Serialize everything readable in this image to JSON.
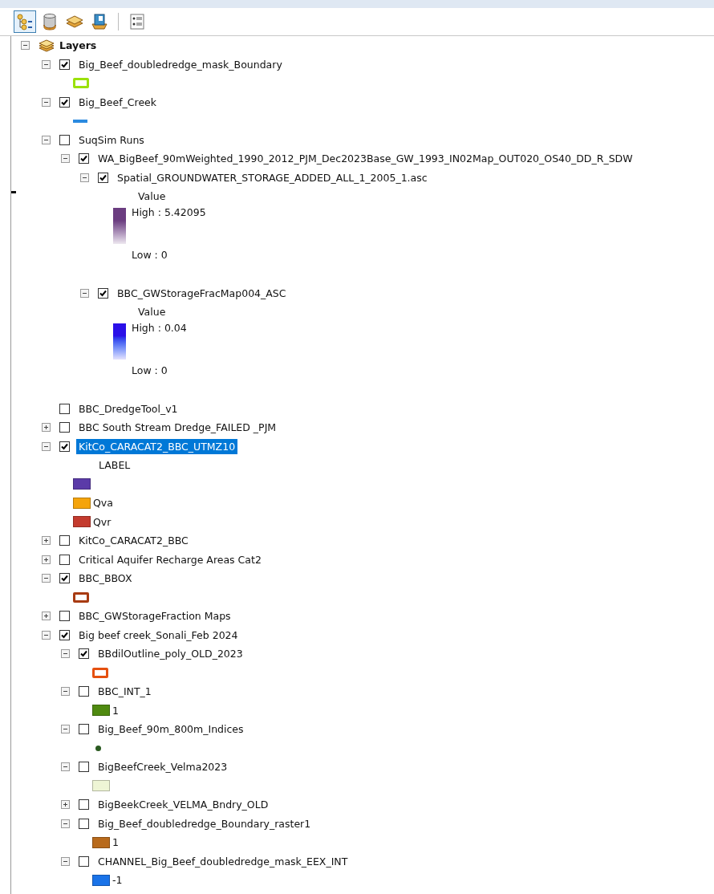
{
  "toolbar": [
    {
      "kind": "drawing-order",
      "selected": true
    },
    {
      "kind": "source",
      "selected": false
    },
    {
      "kind": "visibility",
      "selected": false
    },
    {
      "kind": "selection",
      "selected": false
    },
    {
      "kind": "options",
      "selected": false
    }
  ],
  "tree": {
    "label": "Layers",
    "expanded": true,
    "children": [
      {
        "label": "Big_Beef_doubledredge_mask_Boundary",
        "expanded": true,
        "checked": true,
        "selected": false,
        "legend": [
          {
            "kind": "outline",
            "color": "#9be10b"
          }
        ]
      },
      {
        "label": "Big_Beef_Creek",
        "expanded": true,
        "checked": true,
        "selected": false,
        "legend": [
          {
            "kind": "line",
            "color": "#2b8ae0"
          }
        ]
      },
      {
        "label": "SuqSim Runs",
        "expanded": true,
        "checked": false,
        "selected": false,
        "children": [
          {
            "label": "WA_BigBeef_90mWeighted_1990_2012_PJM_Dec2023Base_GW_1993_IN02Map_OUT020_OS40_DD_R_SDW",
            "expanded": true,
            "checked": true,
            "selected": false,
            "children": [
              {
                "label": "Spatial_GROUNDWATER_STORAGE_ADDED_ALL_1_2005_1.asc",
                "expanded": true,
                "checked": true,
                "selected": false,
                "legend": [
                  {
                    "kind": "gradient",
                    "heading": "Value",
                    "high": "High : 5.42095",
                    "low": "Low : 0",
                    "color": "#6b3d80"
                  }
                ]
              },
              {
                "label": "BBC_GWStorageFracMap004_ASC",
                "expanded": true,
                "checked": true,
                "selected": false,
                "legend": [
                  {
                    "kind": "gradient",
                    "heading": "Value",
                    "high": "High : 0.04",
                    "low": "Low : 0",
                    "color": "#2a10e8"
                  }
                ]
              }
            ]
          }
        ]
      },
      {
        "label": "BBC_DredgeTool_v1",
        "checked": false,
        "selected": false
      },
      {
        "label": "BBC South Stream Dredge_FAILED _PJM",
        "expanded": false,
        "checked": false,
        "selected": false
      },
      {
        "label": "KitCo_CARACAT2_BBC_UTMZ10",
        "expanded": true,
        "checked": true,
        "selected": true,
        "legend": [
          {
            "kind": "heading",
            "label": "LABEL"
          },
          {
            "kind": "swatch",
            "color": "#5b3ba8"
          },
          {
            "kind": "swatch",
            "color": "#f5a40b",
            "label": "Qva"
          },
          {
            "kind": "swatch",
            "color": "#c43b2e",
            "label": "Qvr"
          }
        ]
      },
      {
        "label": "KitCo_CARACAT2_BBC",
        "expanded": false,
        "checked": false,
        "selected": false
      },
      {
        "label": "Critical Aquifer Recharge Areas Cat2",
        "expanded": false,
        "checked": false,
        "selected": false
      },
      {
        "label": "BBC_BBOX",
        "expanded": true,
        "checked": true,
        "selected": false,
        "legend": [
          {
            "kind": "outline",
            "color": "#a83b12"
          }
        ]
      },
      {
        "label": "BBC_GWStorageFraction Maps",
        "expanded": false,
        "checked": false,
        "selected": false
      },
      {
        "label": "Big beef creek_Sonali_Feb 2024",
        "expanded": true,
        "checked": true,
        "selected": false,
        "children": [
          {
            "label": "BBdilOutline_poly_OLD_2023",
            "expanded": true,
            "checked": true,
            "selected": false,
            "legend": [
              {
                "kind": "outline",
                "color": "#e5500f"
              }
            ]
          },
          {
            "label": "BBC_INT_1",
            "expanded": true,
            "checked": false,
            "selected": false,
            "legend": [
              {
                "kind": "swatch",
                "color": "#4f8a10",
                "label": "1"
              }
            ]
          },
          {
            "label": "Big_Beef_90m_800m_Indices",
            "expanded": true,
            "checked": false,
            "selected": false,
            "legend": [
              {
                "kind": "point",
                "color": "#2a5a20"
              }
            ]
          },
          {
            "label": "BigBeefCreek_Velma2023",
            "expanded": true,
            "checked": false,
            "selected": false,
            "legend": [
              {
                "kind": "swatch",
                "color": "#eef5d5"
              }
            ]
          },
          {
            "label": "BigBeekCreek_VELMA_Bndry_OLD",
            "expanded": false,
            "checked": false,
            "selected": false
          },
          {
            "label": "Big_Beef_doubledredge_Boundary_raster1",
            "expanded": true,
            "checked": false,
            "selected": false,
            "legend": [
              {
                "kind": "swatch",
                "color": "#b86a1c",
                "label": "1"
              }
            ]
          },
          {
            "label": "CHANNEL_Big_Beef_doubledredge_mask_EEX_INT",
            "expanded": true,
            "checked": false,
            "selected": false,
            "legend": [
              {
                "kind": "swatch",
                "color": "#1a73e8",
                "label": "-1"
              }
            ]
          }
        ]
      }
    ]
  }
}
